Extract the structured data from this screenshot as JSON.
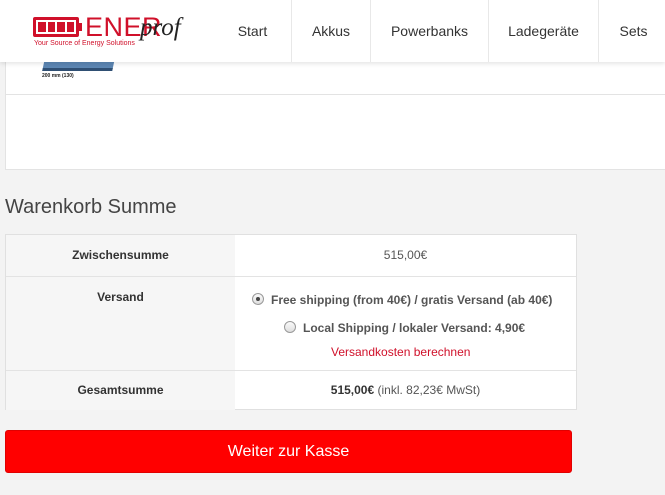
{
  "header": {
    "logo": {
      "brand_main": "ENER",
      "brand_sub": "prof",
      "tagline": "Your Source of Energy Solutions"
    },
    "nav": [
      {
        "label": "Start"
      },
      {
        "label": "Akkus"
      },
      {
        "label": "Powerbanks"
      },
      {
        "label": "Ladegeräte"
      },
      {
        "label": "Sets"
      }
    ]
  },
  "product": {
    "thumb_caption": "200 mm (130)"
  },
  "cart_totals": {
    "title": "Warenkorb Summe",
    "subtotal_label": "Zwischensumme",
    "subtotal_value": "515,00€",
    "shipping_label": "Versand",
    "shipping_options": [
      {
        "label": "Free shipping (from 40€) / gratis Versand (ab 40€)",
        "selected": true
      },
      {
        "label": "Local Shipping / lokaler Versand: 4,90€",
        "selected": false
      }
    ],
    "calculate_shipping_link": "Versandkosten berechnen",
    "total_label": "Gesamtsumme",
    "total_value": "515,00€",
    "total_tax_note": "(inkl. 82,23€ MwSt)"
  },
  "checkout_button": "Weiter zur Kasse",
  "colors": {
    "brand": "#d0102a",
    "button": "#ff0000"
  }
}
